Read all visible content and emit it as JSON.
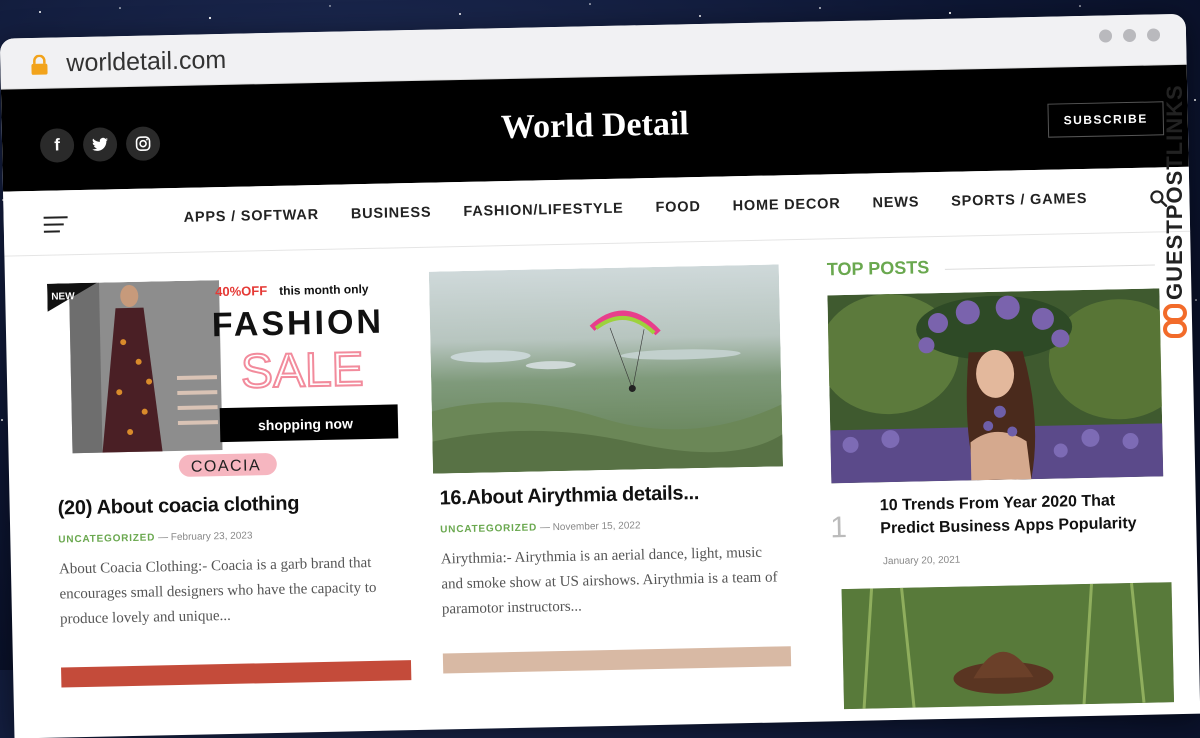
{
  "browser": {
    "url": "worldetail.com"
  },
  "site": {
    "logo": "World Detail",
    "subscribe_label": "SUBSCRIBE",
    "socials": [
      {
        "icon": "facebook-icon",
        "glyph": "f"
      },
      {
        "icon": "twitter-icon",
        "glyph": "t"
      },
      {
        "icon": "instagram-icon",
        "glyph": "◎"
      }
    ]
  },
  "nav": {
    "items": [
      "APPS / SOFTWAR",
      "BUSINESS",
      "FASHION/LIFESTYLE",
      "FOOD",
      "HOME DECOR",
      "NEWS",
      "SPORTS / GAMES"
    ]
  },
  "posts": [
    {
      "title": "(20) About coacia clothing",
      "category": "UNCATEGORIZED",
      "date": "February 23, 2023",
      "excerpt": "About Coacia Clothing:- Coacia is a garb brand that encourages small designers who have the capacity to produce lovely and unique...",
      "banner": {
        "offer": "40%OFF",
        "offer_suffix": "this month only",
        "headline": "FASHION",
        "sale": "SALE",
        "cta": "shopping now",
        "brand": "COACIA",
        "corner": "NEW"
      }
    },
    {
      "title": "16.About Airythmia details...",
      "category": "UNCATEGORIZED",
      "date": "November 15, 2022",
      "excerpt": "Airythmia:- Airythmia is an aerial dance, light, music and smoke show at US airshows. Airythmia is a team of paramotor instructors..."
    }
  ],
  "sidebar": {
    "heading": "TOP POSTS",
    "top_post": {
      "rank": "1",
      "title": "10 Trends From Year 2020 That Predict Business Apps Popularity",
      "date": "January 20, 2021"
    }
  },
  "watermark": {
    "text": "GUESTPOSTLINKS"
  },
  "colors": {
    "accent": "#6aa84f",
    "header_bg": "#000000",
    "sale_pink": "#f28b9c",
    "offer_red": "#e53935"
  }
}
